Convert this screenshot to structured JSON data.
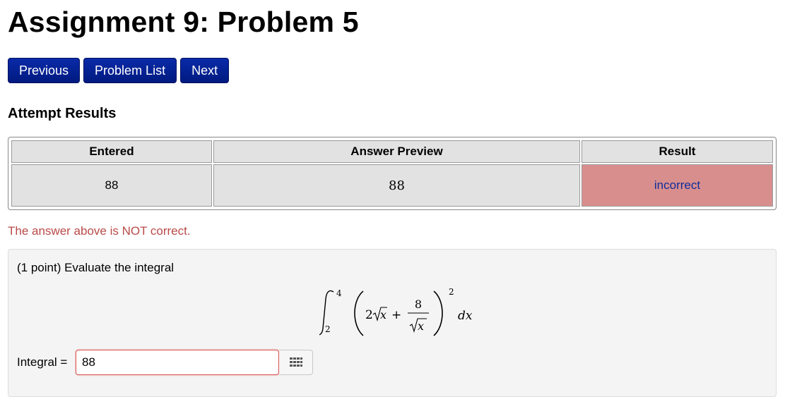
{
  "page": {
    "title": "Assignment 9: Problem 5"
  },
  "nav": {
    "previous_label": "Previous",
    "problem_list_label": "Problem List",
    "next_label": "Next"
  },
  "attempt": {
    "heading": "Attempt Results",
    "columns": [
      "Entered",
      "Answer Preview",
      "Result"
    ],
    "row": {
      "entered": "88",
      "preview": "88",
      "result": "incorrect"
    },
    "message": "The answer above is NOT correct."
  },
  "problem": {
    "statement": "(1 point) Evaluate the integral",
    "integral": {
      "lower": "2",
      "upper": "4",
      "coef": "2",
      "var": "x",
      "plus": "+",
      "numerator": "8",
      "exponent": "2",
      "differential": "dx"
    },
    "answer_label": "Integral =",
    "answer_value": "88",
    "palette_icon": "grid-icon"
  },
  "colors": {
    "nav_button": "#001a8f",
    "incorrect_bg": "#d98e8e",
    "error_text": "#b94a48",
    "panel_bg": "#f4f4f4"
  }
}
